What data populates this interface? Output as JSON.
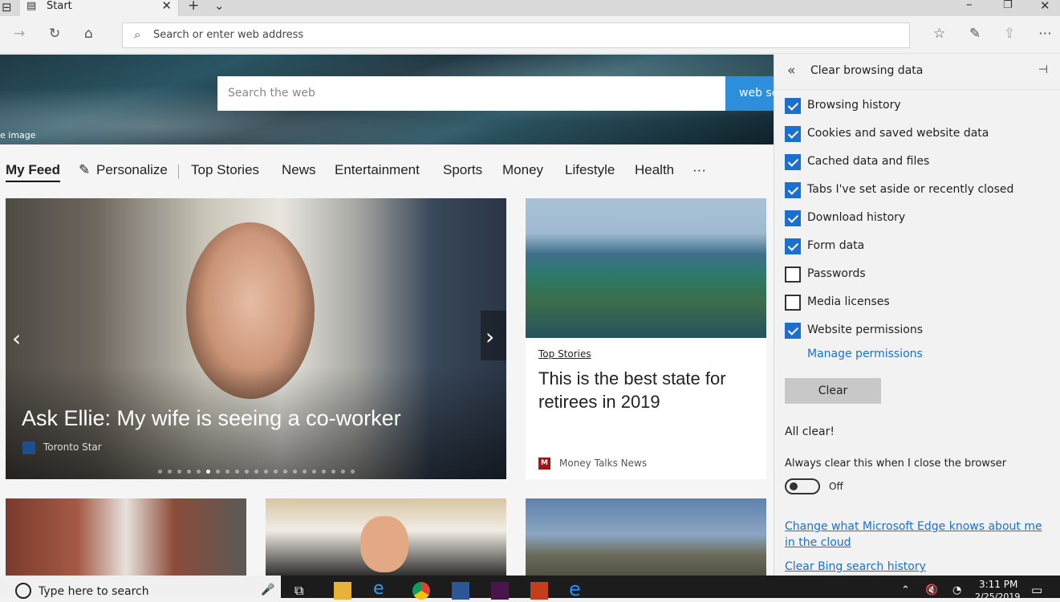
{
  "browser": {
    "tab_title": "Start",
    "address_placeholder": "Search or enter web address"
  },
  "page": {
    "hero_caption": "e image",
    "search_placeholder": "Search the web",
    "search_button": "web se",
    "feed_nav": [
      "My Feed",
      "Personalize",
      "Top Stories",
      "News",
      "Entertainment",
      "Sports",
      "Money",
      "Lifestyle",
      "Health",
      "···"
    ],
    "main_story": {
      "headline": "Ask Ellie: My wife is seeing a co-worker",
      "source": "Toronto Star",
      "slides": 21,
      "active_slide": 5
    },
    "side_story": {
      "category": "Top Stories",
      "title": "This is the best state for retirees in 2019",
      "source": "Money Talks News",
      "source_logo": "M"
    }
  },
  "panel": {
    "title": "Clear browsing data",
    "options": [
      {
        "label": "Browsing history",
        "checked": true
      },
      {
        "label": "Cookies and saved website data",
        "checked": true
      },
      {
        "label": "Cached data and files",
        "checked": true
      },
      {
        "label": "Tabs I've set aside or recently closed",
        "checked": true
      },
      {
        "label": "Download history",
        "checked": true
      },
      {
        "label": "Form data",
        "checked": true
      },
      {
        "label": "Passwords",
        "checked": false
      },
      {
        "label": "Media licenses",
        "checked": false
      },
      {
        "label": "Website permissions",
        "checked": true
      }
    ],
    "manage_link": "Manage permissions",
    "clear_button": "Clear",
    "status": "All clear!",
    "always_clear_label": "Always clear this when I close the browser",
    "toggle_state": "Off",
    "cloud_link": "Change what Microsoft Edge knows about me in the cloud",
    "bing_link": "Clear Bing search history"
  },
  "taskbar": {
    "search_placeholder": "Type here to search",
    "time": "3:11 PM",
    "date": "2/25/2019"
  },
  "icons": {
    "back": "back-arrow-icon",
    "forward": "forward-arrow-icon",
    "refresh": "refresh-icon",
    "home": "home-icon",
    "favorites": "favorites-icon",
    "pen": "pen-icon",
    "share": "share-icon",
    "more": "more-icon"
  }
}
